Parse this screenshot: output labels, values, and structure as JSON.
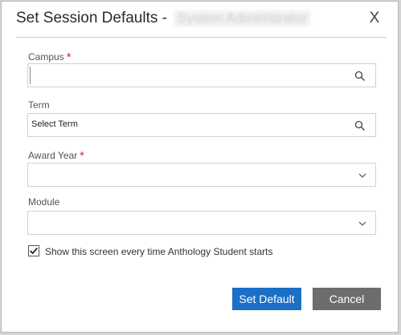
{
  "dialog": {
    "title": "Set Session Defaults -",
    "user_name": "System Administrator",
    "close_label": "X"
  },
  "campus": {
    "label": "Campus",
    "required_mark": "*",
    "value": ""
  },
  "term": {
    "label": "Term",
    "value": "Select Term"
  },
  "award_year": {
    "label": "Award Year",
    "required_mark": "*",
    "value": ""
  },
  "module": {
    "label": "Module",
    "value": ""
  },
  "show_screen": {
    "label": "Show this screen every time Anthology Student starts",
    "checked": true
  },
  "buttons": {
    "set_default": "Set Default",
    "cancel": "Cancel"
  },
  "colors": {
    "primary": "#1a6fc6",
    "secondary": "#6d6d6d",
    "required": "#d62d2d"
  },
  "icons": [
    "close-icon",
    "search-icon",
    "chevron-down-icon",
    "checkmark-icon"
  ]
}
